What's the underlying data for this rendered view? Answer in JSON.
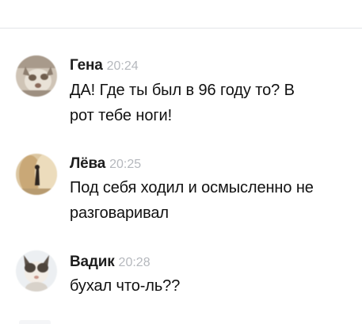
{
  "messages": [
    {
      "author": "Гена",
      "time": "20:24",
      "lines": [
        "ДА! Где ты был в 96 году то? В",
        "рот тебе ноги!"
      ],
      "avatar_icon": "user-avatar-cat-photo"
    },
    {
      "author": "Лёва",
      "time": "20:25",
      "lines": [
        "Под себя ходил и осмысленно не",
        "разговаривал"
      ],
      "avatar_icon": "user-avatar-photo"
    },
    {
      "author": "Вадик",
      "time": "20:28",
      "lines": [
        "бухал что-ль??"
      ],
      "avatar_icon": "user-avatar-cat-photo"
    }
  ],
  "colors": {
    "author": "#1d1d1d",
    "time": "#b5b8bd",
    "text": "#111111",
    "divider": "#e3e5e8",
    "background": "#ffffff"
  }
}
